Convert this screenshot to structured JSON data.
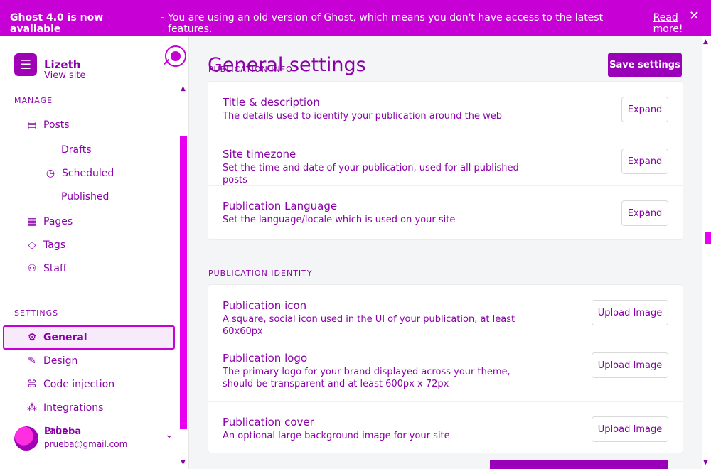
{
  "banner": {
    "headline": "Ghost 4.0 is now available",
    "separator": "-",
    "message": "You are using an old version of Ghost, which means you don't have access to the latest features.",
    "link": "Read more!",
    "close_icon": "close-icon"
  },
  "sidebar": {
    "site_name": "Lizeth",
    "view_site": "View site",
    "manage_label": "MANAGE",
    "settings_label": "SETTINGS",
    "manage_items": [
      {
        "label": "Posts",
        "icon": "posts-icon"
      },
      {
        "label": "Drafts",
        "icon": "drafts-icon"
      },
      {
        "label": "Scheduled",
        "icon": "scheduled-icon"
      },
      {
        "label": "Published",
        "icon": "published-icon"
      },
      {
        "label": "Pages",
        "icon": "pages-icon"
      },
      {
        "label": "Tags",
        "icon": "tags-icon"
      },
      {
        "label": "Staff",
        "icon": "staff-icon"
      }
    ],
    "settings_items": [
      {
        "label": "General",
        "icon": "gear-icon"
      },
      {
        "label": "Design",
        "icon": "brush-icon"
      },
      {
        "label": "Code injection",
        "icon": "code-icon"
      },
      {
        "label": "Integrations",
        "icon": "integrations-icon"
      },
      {
        "label": "Labs",
        "icon": "flask-icon"
      }
    ],
    "user": {
      "name": "Prueba",
      "email": "prueba@gmail.com"
    }
  },
  "main": {
    "title": "General settings",
    "save_label": "Save settings",
    "publication_info_label": "PUBLICATION INFO",
    "publication_identity_label": "PUBLICATION IDENTITY",
    "info_rows": [
      {
        "title": "Title & description",
        "desc": "The details used to identify your publication around the web",
        "button": "Expand"
      },
      {
        "title": "Site timezone",
        "desc": "Set the time and date of your publication, used for all published posts",
        "button": "Expand"
      },
      {
        "title": "Publication Language",
        "desc": "Set the language/locale which is used on your site",
        "button": "Expand"
      }
    ],
    "identity_rows": [
      {
        "title": "Publication icon",
        "desc": "A square, social icon used in the UI of your publication, at least 60x60px",
        "button": "Upload Image"
      },
      {
        "title": "Publication logo",
        "desc": "The primary logo for your brand displayed across your theme, should be transparent and at least 600px x 72px",
        "button": "Upload Image"
      },
      {
        "title": "Publication cover",
        "desc": "An optional large background image for your site",
        "button": "Upload Image"
      }
    ]
  }
}
